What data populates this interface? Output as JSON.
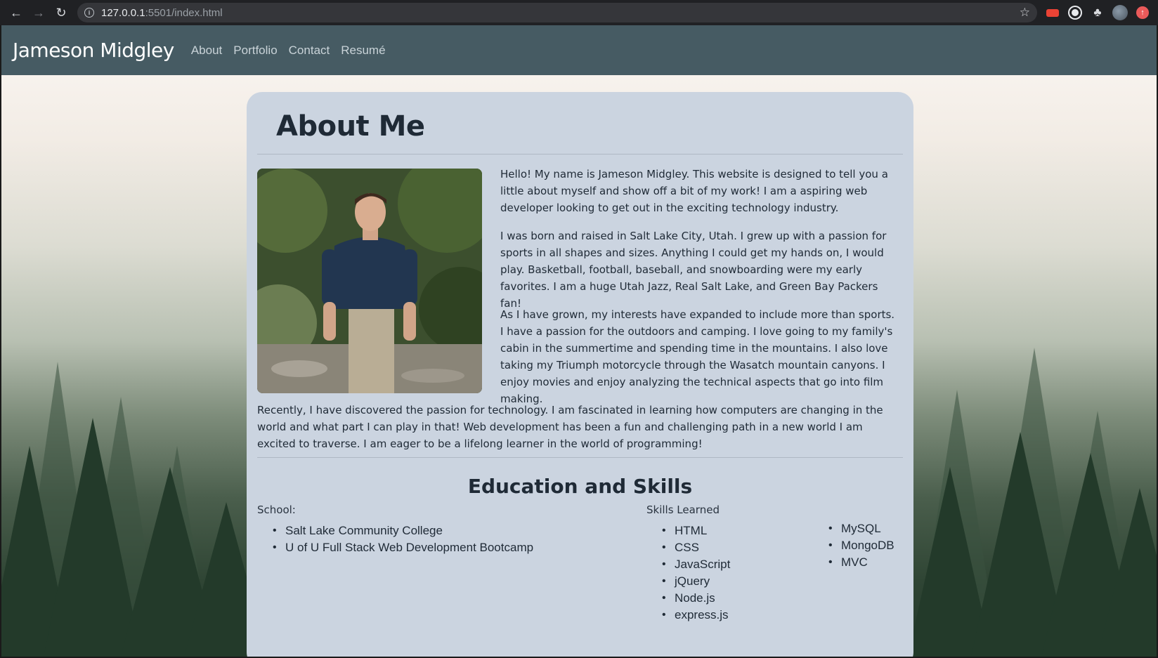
{
  "browser": {
    "url_host": "127.0.0.1",
    "url_path": ":5501/index.html",
    "icons": [
      "back-icon",
      "forward-icon",
      "reload-icon",
      "info-icon",
      "star-icon",
      "extension-icon",
      "avatar"
    ]
  },
  "navbar": {
    "brand": "Jameson Midgley",
    "links": [
      "About",
      "Portfolio",
      "Contact",
      "Resumé"
    ]
  },
  "about": {
    "title": "About Me",
    "paragraphs": [
      "Hello! My name is Jameson Midgley. This website is designed to tell you a little about myself and show off a bit of my work! I am a aspiring web developer looking to get out in the exciting technology industry.",
      "I was born and raised in Salt Lake City, Utah. I grew up with a passion for sports in all shapes and sizes. Anything I could get my hands on, I would play. Basketball, football, baseball, and snowboarding were my early favorites. I am a huge Utah Jazz, Real Salt Lake, and Green Bay Packers fan!",
      "As I have grown, my interests have expanded to include more than sports. I have a passion for the outdoors and camping. I love going to my family's cabin in the summertime and spending time in the mountains. I also love taking my Triumph motorcycle through the Wasatch mountain canyons. I enjoy movies and enjoy analyzing the technical aspects that go into film making.",
      "Recently, I have discovered the passion for technology. I am fascinated in learning how computers are changing in the world and what part I can play in that! Web development has been a fun and challenging path in a new world I am excited to traverse. I am eager to be a lifelong learner in the world of programming!"
    ]
  },
  "education": {
    "title": "Education and Skills",
    "school_label": "School:",
    "schools": [
      "Salt Lake Community College",
      "U of U Full Stack Web Development Bootcamp"
    ],
    "skills_label": "Skills Learned",
    "skills_col1": [
      "HTML",
      "CSS",
      "JavaScript",
      "jQuery",
      "Node.js",
      "express.js"
    ],
    "skills_col2": [
      "MySQL",
      "MongoDB",
      "MVC"
    ]
  },
  "colors": {
    "navbar": "#465b63",
    "card": "#cbd4e0",
    "text": "#1f2a36"
  }
}
